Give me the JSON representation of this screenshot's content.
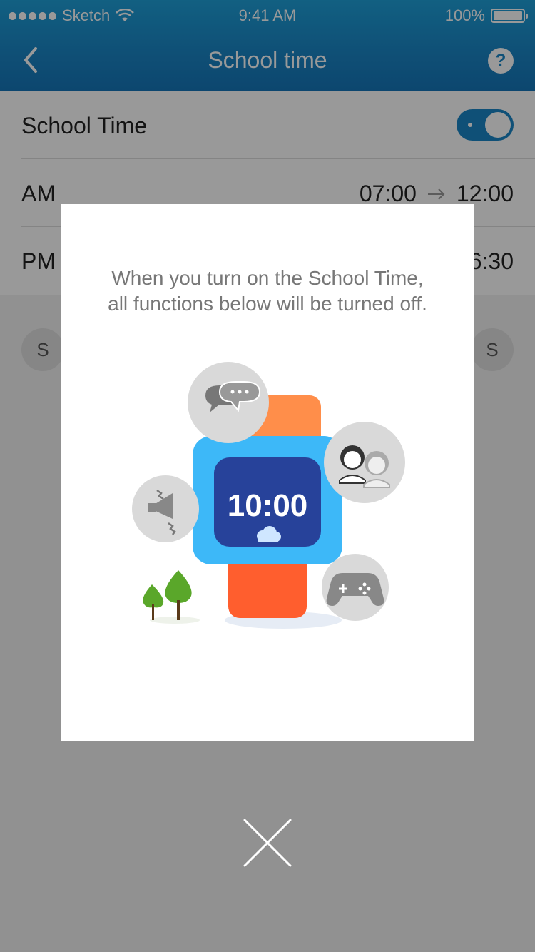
{
  "status_bar": {
    "carrier": "Sketch",
    "time": "9:41 AM",
    "battery": "100%"
  },
  "nav": {
    "title": "School time",
    "help_label": "?"
  },
  "settings": {
    "school_time_label": "School Time",
    "school_time_enabled": true,
    "am_label": "AM",
    "am_start": "07:00",
    "am_end": "12:00",
    "pm_label": "PM",
    "pm_end_partial": "6:30"
  },
  "days": {
    "first_label": "S",
    "last_label": "S"
  },
  "modal": {
    "message_line1": "When you turn on the School Time,",
    "message_line2": "all functions below will be turned off.",
    "watch_time": "10:00",
    "icons": [
      "chat-icon",
      "contacts-icon",
      "megaphone-icon",
      "gamepad-icon",
      "cloud-icon",
      "tree-icon"
    ]
  },
  "colors": {
    "header_blue": "#1a86c6",
    "toggle_on": "#1a86c6",
    "watch_band_top": "#ff8e4a",
    "watch_band_bottom": "#ff5e2e",
    "watch_body": "#3db8f8",
    "watch_screen": "#27429a",
    "tree_green": "#5aa72a"
  }
}
